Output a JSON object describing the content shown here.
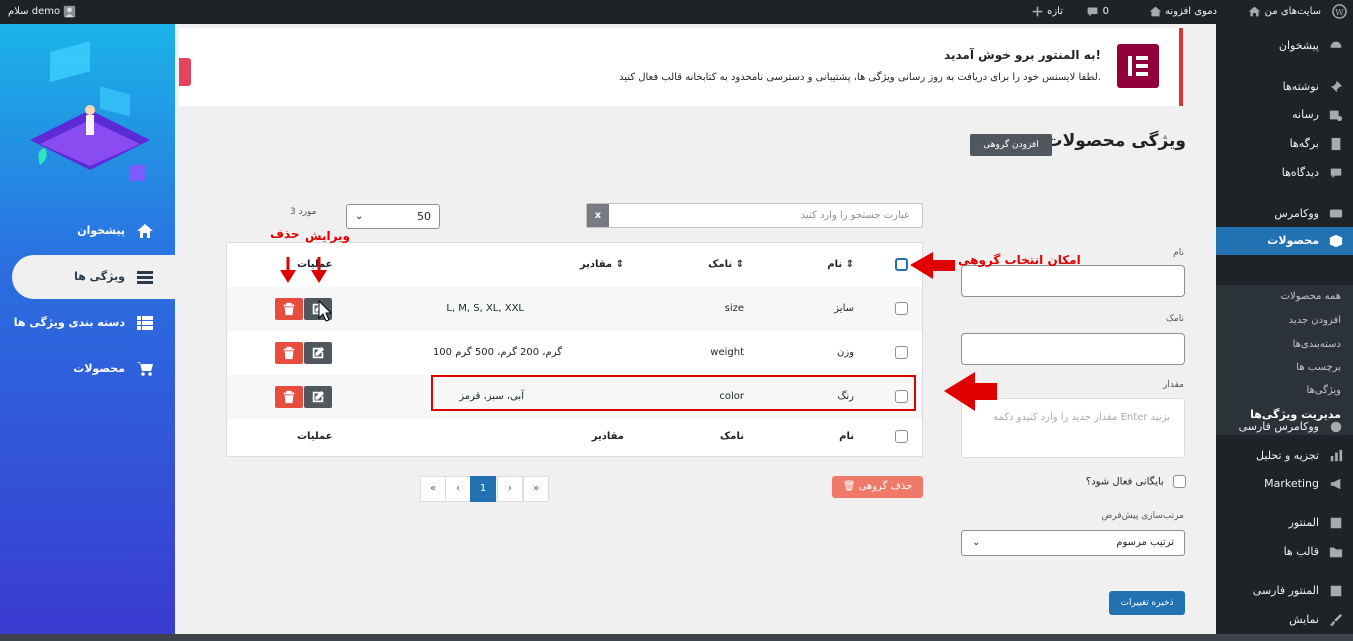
{
  "adminbar": {
    "greeting": "سلام demo",
    "my_sites": "سایت‌های من",
    "site_name": "دموی افزونه",
    "comments_count": "0",
    "new_label": "تازه"
  },
  "sidebar": {
    "items": [
      {
        "label": "پیشخوان"
      },
      {
        "label": "نوشته‌ها"
      },
      {
        "label": "رسانه"
      },
      {
        "label": "برگه‌ها"
      },
      {
        "label": "دیدگاه‌ها"
      },
      {
        "label": "ووکامرس"
      },
      {
        "label": "محصولات"
      },
      {
        "label": "ووکامرس فارسی"
      },
      {
        "label": "تجزیه و تحلیل"
      },
      {
        "label": "Marketing"
      },
      {
        "label": "المنتور"
      },
      {
        "label": "قالب ها"
      },
      {
        "label": "المنتور فارسی"
      },
      {
        "label": "نمایش"
      }
    ],
    "submenu": [
      {
        "label": "همه محصولات"
      },
      {
        "label": "افزودن جدید"
      },
      {
        "label": "دسته‌بندی‌ها"
      },
      {
        "label": "برچسب ها"
      },
      {
        "label": "ویژگی‌ها"
      },
      {
        "label": "مدیریت ویژگی‌ها"
      }
    ]
  },
  "left_panel": {
    "items": [
      {
        "label": "پیشخوان"
      },
      {
        "label": "ویژگی ها"
      },
      {
        "label": "دسته بندی ویژگی ها"
      },
      {
        "label": "محصولات"
      }
    ]
  },
  "notice": {
    "title": "به المنتور برو خوش آمدید!",
    "text": "لطفا لایسنس خود را برای دریافت به روز رسانی ویژگی ها، پشتیبانی و دسترسی نامحدود به کتابخانه قالب فعال کنید."
  },
  "page": {
    "title": "ویژگی محصولات",
    "bulk_add": "افزودن گروهی"
  },
  "form": {
    "name_label": "نام",
    "slug_label": "نامک",
    "value_label": "مقدار",
    "value_placeholder": "مقدار جدید را وارد کنیدو دکمه Enter بزنید",
    "archive_label": "بایگانی فعال شود؟",
    "sort_label": "مرتب‌سازی پیش‌فرض",
    "sort_value": "ترتیب مرسوم",
    "save_label": "ذخیره تغییرات"
  },
  "list": {
    "search_placeholder": "عبارت جستجو را وارد کنید",
    "search_clear": "x",
    "per_page": "50",
    "count": "3 مورد",
    "headers": {
      "name": "نام",
      "slug": "نامک",
      "values": "مقادیر",
      "actions": "عملیات"
    },
    "rows": [
      {
        "name": "سایز",
        "slug": "size",
        "values": "L, M, S, XL, XXL"
      },
      {
        "name": "وزن",
        "slug": "weight",
        "values": "100 گرم، 200 گرم، 500 گرم"
      },
      {
        "name": "رنگ",
        "slug": "color",
        "values": "آبی، سبز، قرمز"
      }
    ],
    "pager": {
      "first": "«",
      "prev": "‹",
      "current": "1",
      "next": "›",
      "last": "»"
    },
    "bulk_delete": "حذف گروهی"
  },
  "annotations": {
    "edit": "ویرایش",
    "delete": "حذف",
    "bulk_select": "امکان انتخاب گروهی"
  },
  "colors": {
    "accent": "#2271b1",
    "danger": "#e74c3c",
    "annotation": "#e00000"
  }
}
